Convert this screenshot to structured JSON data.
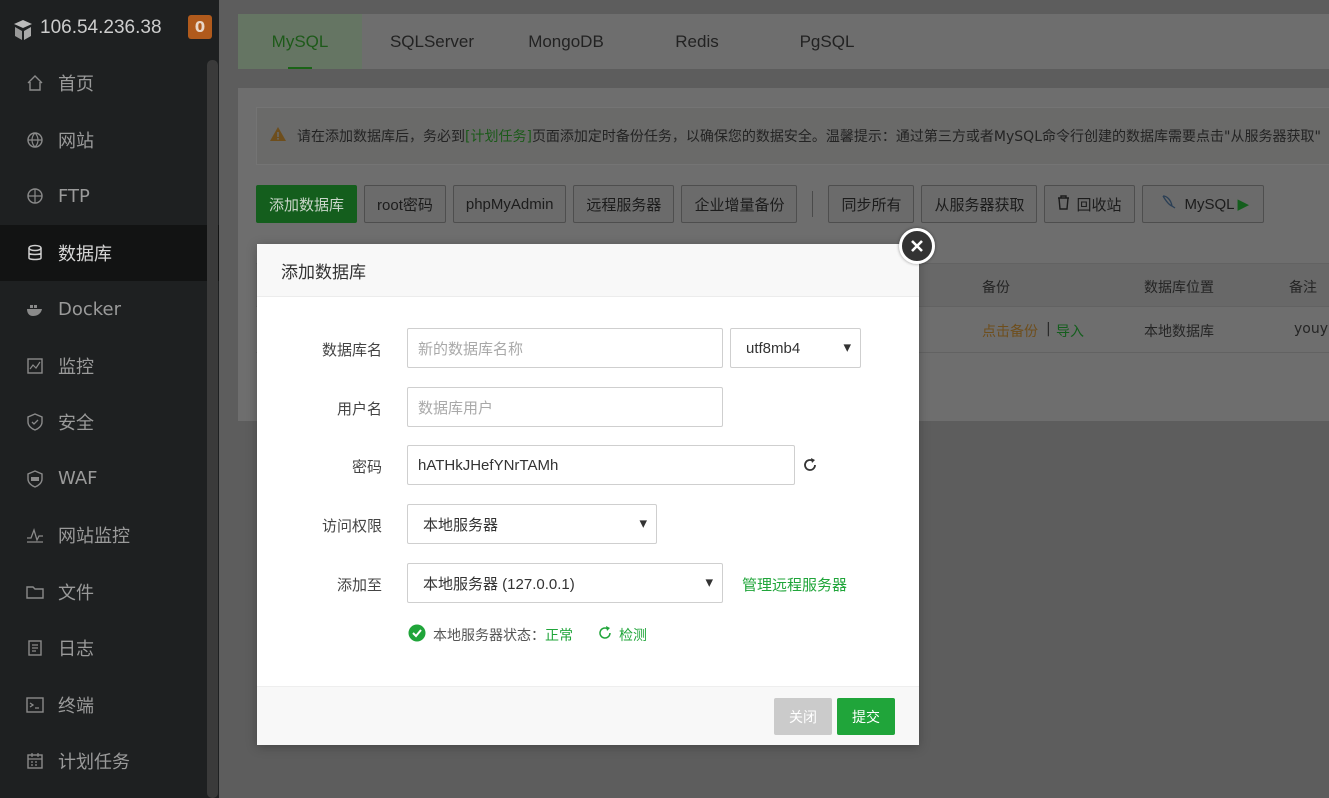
{
  "sidebar": {
    "server_ip": "106.54.236.38",
    "badge_count": "0",
    "items": [
      {
        "label": "首页",
        "icon": "home-icon"
      },
      {
        "label": "网站",
        "icon": "globe-icon"
      },
      {
        "label": "FTP",
        "icon": "ftp-icon"
      },
      {
        "label": "数据库",
        "icon": "database-icon",
        "active": true
      },
      {
        "label": "Docker",
        "icon": "docker-icon"
      },
      {
        "label": "监控",
        "icon": "monitor-icon"
      },
      {
        "label": "安全",
        "icon": "shield-icon"
      },
      {
        "label": "WAF",
        "icon": "waf-icon"
      },
      {
        "label": "网站监控",
        "icon": "site-monitor-icon"
      },
      {
        "label": "文件",
        "icon": "folder-icon"
      },
      {
        "label": "日志",
        "icon": "log-icon"
      },
      {
        "label": "终端",
        "icon": "terminal-icon"
      },
      {
        "label": "计划任务",
        "icon": "calendar-icon"
      }
    ]
  },
  "tabs": [
    "MySQL",
    "SQLServer",
    "MongoDB",
    "Redis",
    "PgSQL"
  ],
  "notice": {
    "pre": "请在添加数据库后，务必到",
    "link": "[计划任务]",
    "post": "页面添加定时备份任务，以确保您的数据安全。温馨提示：通过第三方或者MySQL命令行创建的数据库需要点击\"从服务器获取\""
  },
  "toolbar": {
    "add_db": "添加数据库",
    "root_pwd": "root密码",
    "phpmyadmin": "phpMyAdmin",
    "remote_server": "远程服务器",
    "enterprise_backup": "企业增量备份",
    "sync_all": "同步所有",
    "fetch_from_server": "从服务器获取",
    "recycle_bin": "回收站",
    "mysql_btn": "MySQL"
  },
  "table": {
    "headers": {
      "backup": "备份",
      "location": "数据库位置",
      "remark": "备注"
    },
    "row": {
      "backup_link": "点击备份",
      "separator": "|",
      "import_link": "导入",
      "location": "本地数据库",
      "remark": "youy"
    }
  },
  "modal": {
    "title": "添加数据库",
    "db_name_label": "数据库名",
    "db_name_placeholder": "新的数据库名称",
    "charset": "utf8mb4",
    "username_label": "用户名",
    "username_placeholder": "数据库用户",
    "password_label": "密码",
    "password_value": "hATHkJHefYNrTAMh",
    "access_label": "访问权限",
    "access_value": "本地服务器",
    "add_to_label": "添加至",
    "add_to_value": "本地服务器 (127.0.0.1)",
    "manage_remote": "管理远程服务器",
    "status_label": "本地服务器状态：",
    "status_value": "正常",
    "check": "检测",
    "close_btn": "关闭",
    "submit_btn": "提交"
  },
  "colors": {
    "accent_green": "#20a53a",
    "sidebar_bg": "#1e2021",
    "warning_orange": "#e6a23c",
    "badge": "#b05a1c"
  }
}
